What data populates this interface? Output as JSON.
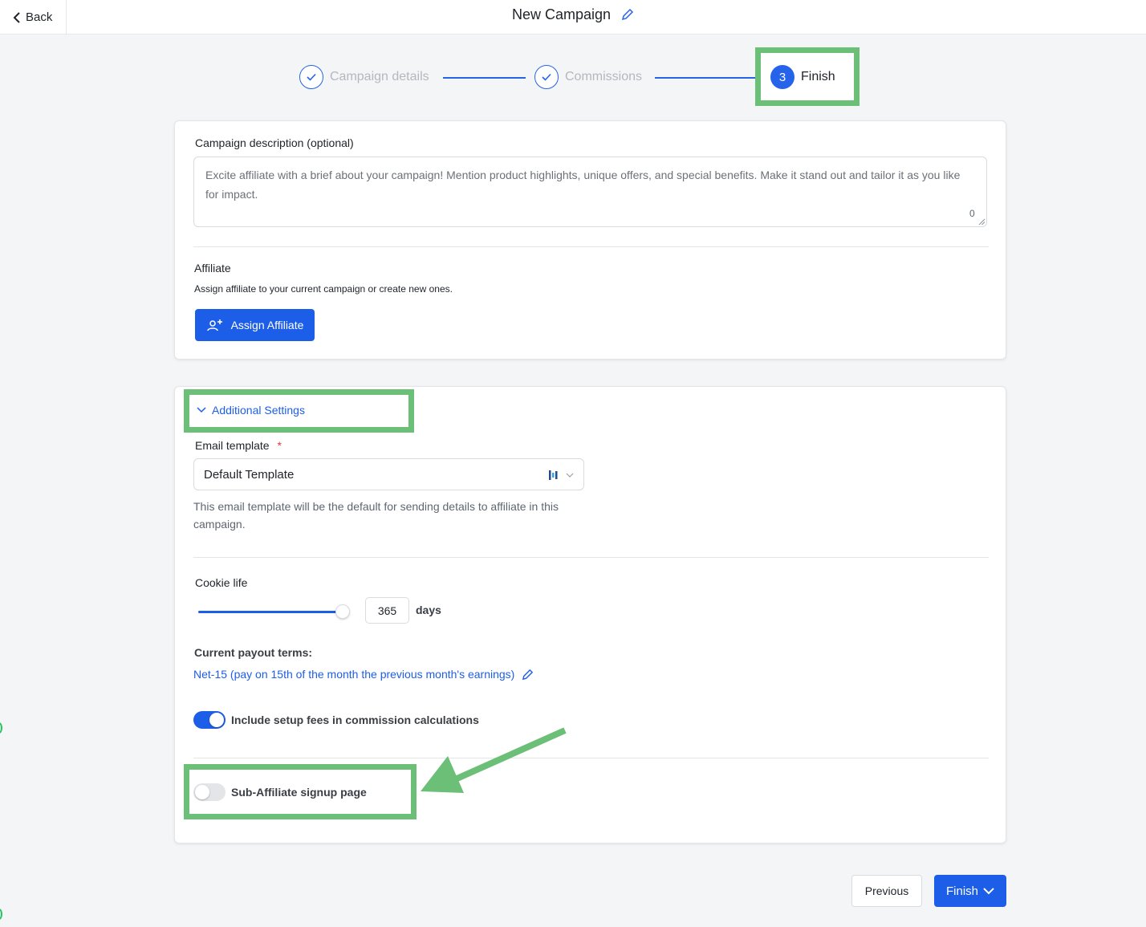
{
  "header": {
    "back_label": "Back",
    "title": "New Campaign"
  },
  "steps": [
    {
      "label": "Campaign details",
      "state": "done"
    },
    {
      "label": "Commissions",
      "state": "done"
    },
    {
      "number": "3",
      "label": "Finish",
      "state": "active"
    }
  ],
  "description": {
    "label": "Campaign description (optional)",
    "placeholder": "Excite affiliate with a brief about your campaign! Mention product highlights, unique offers, and special benefits. Make it stand out and tailor it as you like for impact.",
    "char_count": "0"
  },
  "affiliate": {
    "heading": "Affiliate",
    "subtext": "Assign affiliate to your current campaign or create new ones.",
    "button_label": "Assign Affiliate"
  },
  "additional_settings": {
    "toggle_label": "Additional Settings",
    "email_template": {
      "label": "Email template",
      "required_mark": "*",
      "selected": "Default Template",
      "help": "This email template will be the default for sending details to affiliate in this campaign."
    },
    "cookie_life": {
      "label": "Cookie life",
      "value": "365",
      "unit": "days",
      "slider_fraction": 1.0
    },
    "payout": {
      "label": "Current payout terms:",
      "value": "Net-15 (pay on 15th of the month the previous month's earnings)"
    },
    "setup_fees": {
      "label": "Include setup fees in commission calculations",
      "enabled": true
    },
    "sub_affiliate": {
      "label": "Sub-Affiliate signup page",
      "enabled": false
    }
  },
  "footer": {
    "previous_label": "Previous",
    "finish_label": "Finish"
  },
  "colors": {
    "primary": "#1d5ee8",
    "highlight": "#6cbf77"
  }
}
